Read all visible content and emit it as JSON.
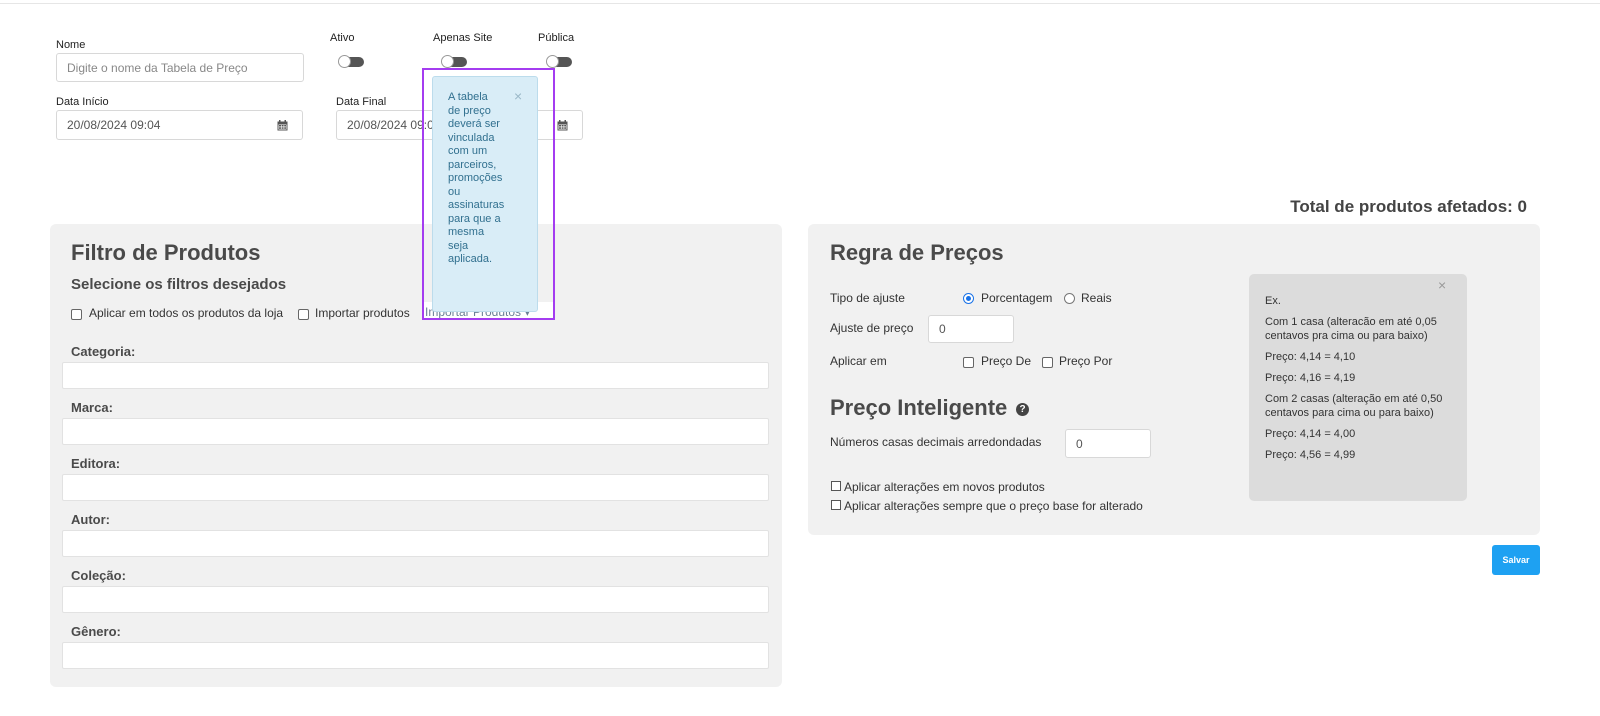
{
  "top_form": {
    "name_label": "Nome",
    "name_placeholder": "Digite o nome da Tabela de Preço",
    "toggle_ativo": "Ativo",
    "toggle_apenas_site": "Apenas Site",
    "toggle_publica": "Pública",
    "data_inicio_label": "Data Início",
    "data_inicio_value": "20/08/2024 09:04",
    "data_final_label": "Data Final",
    "data_final_value": "20/08/2024 09:04",
    "calendar_icon": "calendar-icon"
  },
  "popover": {
    "lines": [
      "A tabela",
      "de preço",
      "deverá ser",
      "vinculada",
      "com um",
      "parceiros,",
      "promoções",
      "ou",
      "assinaturas",
      "para que a",
      "mesma",
      "seja",
      "aplicada."
    ],
    "close": "×"
  },
  "total_afetados": "Total de produtos afetados: 0",
  "filtro": {
    "title": "Filtro de Produtos",
    "subtitle": "Selecione os filtros desejados",
    "aplicar_todos": "Aplicar em todos os produtos da loja",
    "importar": "Importar produtos",
    "importar_dropdown": "Importar Produtos",
    "fields": [
      "Categoria:",
      "Marca:",
      "Editora:",
      "Autor:",
      "Coleção:",
      "Gênero:"
    ]
  },
  "regra": {
    "title": "Regra de Preços",
    "tipo_ajuste_label": "Tipo de ajuste",
    "opt_porcentagem": "Porcentagem",
    "opt_reais": "Reais",
    "ajuste_label": "Ajuste de preço",
    "ajuste_value": "0",
    "aplicar_em_label": "Aplicar em",
    "preco_de": "Preço De",
    "preco_por": "Preço Por",
    "inteligente_title": "Preço Inteligente",
    "casas_label": "Números casas decimais arredondadas",
    "casas_value": "0",
    "novos_produtos": "Aplicar alterações em novos produtos",
    "preco_base": "Aplicar alterações sempre que o preço base for alterado"
  },
  "hint": {
    "close": "×",
    "lines": [
      "Ex.",
      "Com 1 casa (alteracão em até 0,05 centavos pra cima ou para baixo)",
      "Preço: 4,14 = 4,10",
      "Preço: 4,16 = 4,19",
      "Com 2 casas (alteração em até 0,50 centavos para cima ou para baixo)",
      "Preço: 4,14 = 4,00",
      "Preço: 4,56 = 4,99"
    ]
  },
  "save_label": "Salvar"
}
